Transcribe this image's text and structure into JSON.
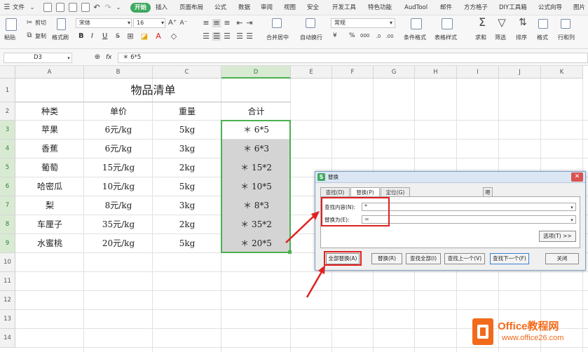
{
  "menubar": {
    "file": "文件",
    "tabs": [
      "开始",
      "插入",
      "页面布局",
      "公式",
      "数据",
      "审阅",
      "视图",
      "安全",
      "开发工具",
      "特色功能",
      "AudTool",
      "邮件",
      "方方格子",
      "DIY工具箱",
      "公式向导",
      "图片"
    ],
    "active_tab": "开始"
  },
  "ribbon": {
    "paste": "粘贴",
    "cut": "剪切",
    "copy": "复制",
    "format_painter": "格式刷",
    "font_name": "宋体",
    "font_size": "16",
    "bold": "B",
    "italic": "I",
    "underline": "U",
    "merge_center": "合并居中",
    "wrap_text": "自动换行",
    "number_format": "常规",
    "currency": "¥",
    "percent": "%",
    "thousands": "000",
    "cond_format": "条件格式",
    "table_style": "表格样式",
    "sum": "求和",
    "filter": "筛选",
    "sort": "排序",
    "format": "格式",
    "rows_cols": "行和列"
  },
  "formula_bar": {
    "cell_ref": "D3",
    "fx": "fx",
    "content": "＊ 6*5"
  },
  "columns": [
    "A",
    "B",
    "C",
    "D",
    "E",
    "F",
    "G",
    "H",
    "I",
    "J",
    "K"
  ],
  "rows": [
    "1",
    "2",
    "3",
    "4",
    "5",
    "6",
    "7",
    "8",
    "9",
    "10",
    "11",
    "12",
    "13",
    "14"
  ],
  "sheet": {
    "title": "物品清单",
    "headers": [
      "种类",
      "单价",
      "重量",
      "合计"
    ],
    "data": [
      [
        "苹果",
        "6元/kg",
        "5kg",
        "＊ 6*5"
      ],
      [
        "香蕉",
        "6元/kg",
        "3kg",
        "＊ 6*3"
      ],
      [
        "葡萄",
        "15元/kg",
        "2kg",
        "＊ 15*2"
      ],
      [
        "哈密瓜",
        "10元/kg",
        "5kg",
        "＊ 10*5"
      ],
      [
        "梨",
        "8元/kg",
        "3kg",
        "＊ 8*3"
      ],
      [
        "车厘子",
        "35元/kg",
        "2kg",
        "＊ 35*2"
      ],
      [
        "水蜜桃",
        "20元/kg",
        "5kg",
        "＊ 20*5"
      ]
    ]
  },
  "dialog": {
    "title": "替换",
    "tabs": [
      "查找(D)",
      "替换(P)",
      "定位(G)"
    ],
    "mini_tab": "嗯",
    "find_label": "查找内容(N):",
    "find_value": "*",
    "replace_label": "替换为(E):",
    "replace_value": "=",
    "options_button": "选项(T) >>",
    "buttons": [
      "全部替换(A)",
      "替换(R)",
      "查找全部(I)",
      "查找上一个(V)",
      "查找下一个(F)",
      "关闭"
    ]
  },
  "watermark": {
    "brand": "Office教程网",
    "url": "www.office26.com"
  },
  "colors": {
    "accent_green": "#3fa85f",
    "selection_green": "#4caf50",
    "highlight_red": "#e02020",
    "watermark_orange": "#f26a1b"
  }
}
